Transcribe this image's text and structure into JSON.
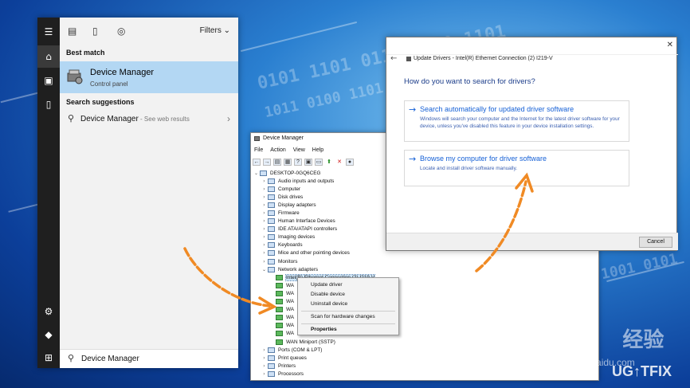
{
  "start_menu": {
    "filters_label": "Filters",
    "best_match_label": "Best match",
    "best_match": {
      "title": "Device Manager",
      "subtitle": "Control panel"
    },
    "suggestions_label": "Search suggestions",
    "suggestion": {
      "text": "Device Manager",
      "web_hint": " - See web results"
    },
    "search_query": "Device Manager"
  },
  "device_manager": {
    "title": "Device Manager",
    "menu": [
      "File",
      "Action",
      "View",
      "Help"
    ],
    "tree": [
      {
        "label": "DESKTOP-0GQ6CEG",
        "indent": 0,
        "expanded": true
      },
      {
        "label": "Audio inputs and outputs",
        "indent": 1
      },
      {
        "label": "Computer",
        "indent": 1
      },
      {
        "label": "Disk drives",
        "indent": 1
      },
      {
        "label": "Display adapters",
        "indent": 1
      },
      {
        "label": "Firmware",
        "indent": 1
      },
      {
        "label": "Human Interface Devices",
        "indent": 1
      },
      {
        "label": "IDE ATA/ATAPI controllers",
        "indent": 1
      },
      {
        "label": "Imaging devices",
        "indent": 1
      },
      {
        "label": "Keyboards",
        "indent": 1
      },
      {
        "label": "Mice and other pointing devices",
        "indent": 1
      },
      {
        "label": "Monitors",
        "indent": 1
      },
      {
        "label": "Network adapters",
        "indent": 1,
        "expanded": true
      },
      {
        "label": "Intel(R) Ethernet Connection (2) I219-V",
        "indent": 2,
        "net": true,
        "selected": true
      },
      {
        "label": "WA",
        "indent": 2,
        "net": true
      },
      {
        "label": "WA",
        "indent": 2,
        "net": true
      },
      {
        "label": "WA",
        "indent": 2,
        "net": true
      },
      {
        "label": "WA",
        "indent": 2,
        "net": true
      },
      {
        "label": "WA",
        "indent": 2,
        "net": true
      },
      {
        "label": "WA",
        "indent": 2,
        "net": true
      },
      {
        "label": "WA",
        "indent": 2,
        "net": true
      },
      {
        "label": "WAN Miniport (SSTP)",
        "indent": 2,
        "net": true
      },
      {
        "label": "Ports (COM & LPT)",
        "indent": 1
      },
      {
        "label": "Print queues",
        "indent": 1
      },
      {
        "label": "Printers",
        "indent": 1
      },
      {
        "label": "Processors",
        "indent": 1
      }
    ],
    "context_menu": {
      "update": "Update driver",
      "disable": "Disable device",
      "uninstall": "Uninstall device",
      "scan": "Scan for hardware changes",
      "properties": "Properties"
    }
  },
  "update_drivers": {
    "title": "Update Drivers - Intel(R) Ethernet Connection (2) I219-V",
    "heading": "How do you want to search for drivers?",
    "option_auto": {
      "title": "Search automatically for updated driver software",
      "desc": "Windows will search your computer and the Internet for the latest driver software for your device, unless you've disabled this feature in your device installation settings."
    },
    "option_browse": {
      "title": "Browse my computer for driver software",
      "desc": "Locate and install driver software manually."
    },
    "cancel_label": "Cancel"
  },
  "watermark": {
    "baidu": "Baidu",
    "jingyan": "经验",
    "url": "jingyan.baidu.com",
    "ugetfix": "UG↑TFIX"
  },
  "colors": {
    "accent_blue": "#1560d6",
    "highlight": "#b3d7f3",
    "arrow_orange": "#f08a24"
  }
}
